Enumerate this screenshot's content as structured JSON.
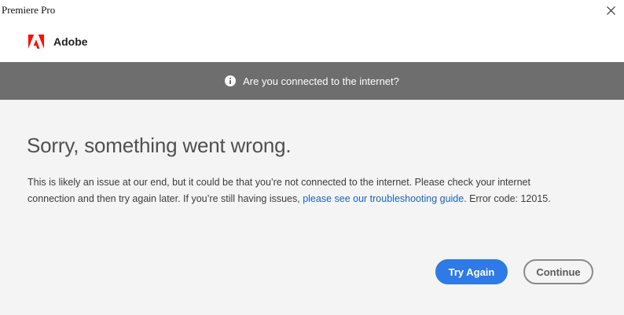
{
  "window": {
    "title": "Premiere Pro"
  },
  "brand": {
    "name": "Adobe",
    "logo_icon": "adobe-logo-icon",
    "color": "#fa0f00"
  },
  "banner": {
    "icon": "info-icon",
    "message": "Are you connected to the internet?",
    "background": "#6e6e6e"
  },
  "error": {
    "heading": "Sorry, something went wrong.",
    "body_before_link": "This is likely an issue at our end, but it could be that you’re not connected to the internet. Please check your internet connection and then try again later. If you’re still having issues, ",
    "link_text": "please see our troubleshooting guide",
    "body_after_link": ". Error code: 12015."
  },
  "actions": {
    "try_again_label": "Try Again",
    "continue_label": "Continue",
    "accent": "#2e7ae6"
  }
}
